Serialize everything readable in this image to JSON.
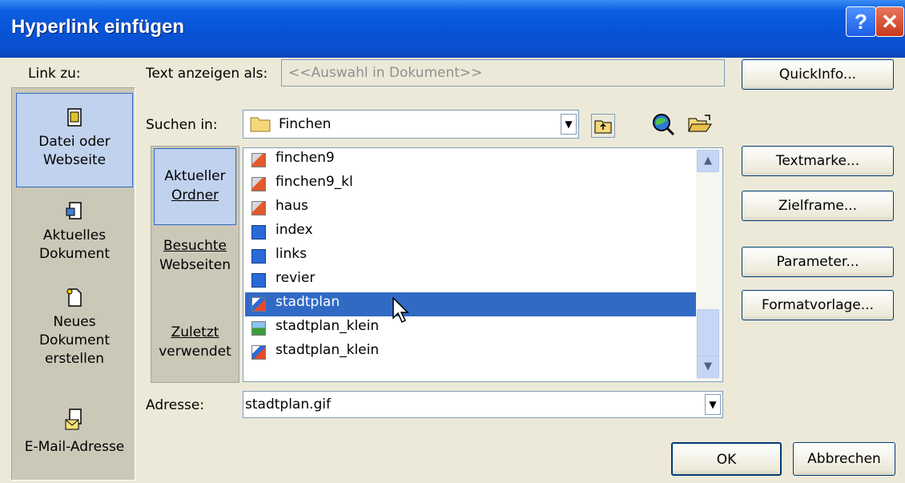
{
  "window": {
    "title": "Hyperlink einfügen",
    "help_glyph": "?",
    "close_glyph": "✕"
  },
  "link_to": {
    "label": "Link zu:",
    "items": [
      {
        "line1": "Datei oder",
        "line2": "Webseite",
        "selected": true,
        "icon": "file-web-icon"
      },
      {
        "line1": "Aktuelles",
        "line2": "Dokument",
        "selected": false,
        "icon": "document-icon"
      },
      {
        "line1": "Neues",
        "line2": "Dokument",
        "line3": "erstellen",
        "selected": false,
        "icon": "new-document-icon"
      },
      {
        "line1": "E-Mail-Adresse",
        "selected": false,
        "icon": "email-icon"
      }
    ]
  },
  "display_text": {
    "label": "Text anzeigen als:",
    "value": "<<Auswahl in Dokument>>"
  },
  "buttons": {
    "quickinfo": "QuickInfo...",
    "textmarke": "Textmarke...",
    "zielframe": "Zielframe...",
    "parameter": "Parameter...",
    "formatvorlage": "Formatvorlage...",
    "ok": "OK",
    "cancel": "Abbrechen"
  },
  "look_in": {
    "label": "Suchen in:",
    "value": "Finchen"
  },
  "categories": [
    {
      "line1": "Aktueller",
      "line2": "Ordner",
      "selected": true
    },
    {
      "line1": "Besuchte",
      "line2": "Webseiten",
      "selected": false
    },
    {
      "line1": "Zuletzt",
      "line2": "verwendet",
      "selected": false
    }
  ],
  "files": [
    {
      "name": "finchen9",
      "type": "image-red"
    },
    {
      "name": "finchen9_kl",
      "type": "image-red"
    },
    {
      "name": "haus",
      "type": "image-red"
    },
    {
      "name": "index",
      "type": "ie-page"
    },
    {
      "name": "links",
      "type": "ie-page"
    },
    {
      "name": "revier",
      "type": "ie-page"
    },
    {
      "name": "stadtplan",
      "type": "gif",
      "selected": true
    },
    {
      "name": "stadtplan_klein",
      "type": "image-green"
    },
    {
      "name": "stadtplan_klein",
      "type": "gif"
    }
  ],
  "address": {
    "label": "Adresse:",
    "value": "stadtplan.gif"
  },
  "colors": {
    "title_bar": "#0853d6",
    "selection": "#316ac5",
    "dialog_bg": "#ece9d8"
  }
}
